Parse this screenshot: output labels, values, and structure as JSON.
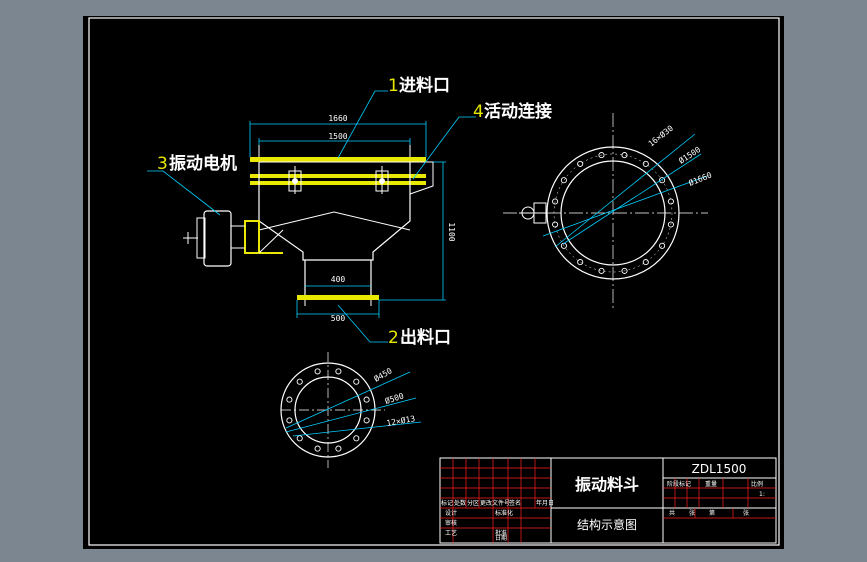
{
  "labels": {
    "inlet": {
      "num": "1",
      "text": "进料口"
    },
    "joint": {
      "num": "4",
      "text": "活动连接"
    },
    "motor": {
      "num": "3",
      "text": "振动电机"
    },
    "outlet": {
      "num": "2",
      "text": "出料口"
    }
  },
  "dimensions": {
    "top_width_outer": "1660",
    "top_width_inner": "1500",
    "height": "1100",
    "outlet_width_inner": "400",
    "outlet_width_outer": "500",
    "top_bolts": "16×Ø30",
    "top_d_inner": "Ø1500",
    "top_d_outer": "Ø1660",
    "bot_d_inner": "Ø450",
    "bot_d_outer": "Ø500",
    "bot_bolts": "12×Ø13"
  },
  "title_block": {
    "title": "振动料斗",
    "subtitle": "结构示意图",
    "drawing_no": "ZDL1500",
    "row_labels": [
      "标记",
      "处数",
      "分区",
      "更改文件号",
      "签名",
      "年月日"
    ],
    "sign_labels": [
      "设计",
      "标准化",
      "审核",
      "工艺",
      "批准"
    ],
    "right_labels": [
      "阶段标记",
      "重量",
      "比例"
    ],
    "right_labels2": [
      "共",
      "张",
      "第",
      "张"
    ],
    "date_label": "日期",
    "scale_value": "1:"
  },
  "colors": {
    "background": "#7c8690",
    "sheet": "#000000",
    "line": "#ffffff",
    "flange": "#e8e800",
    "dimension": "#00cfff",
    "table": "#ff2020"
  }
}
